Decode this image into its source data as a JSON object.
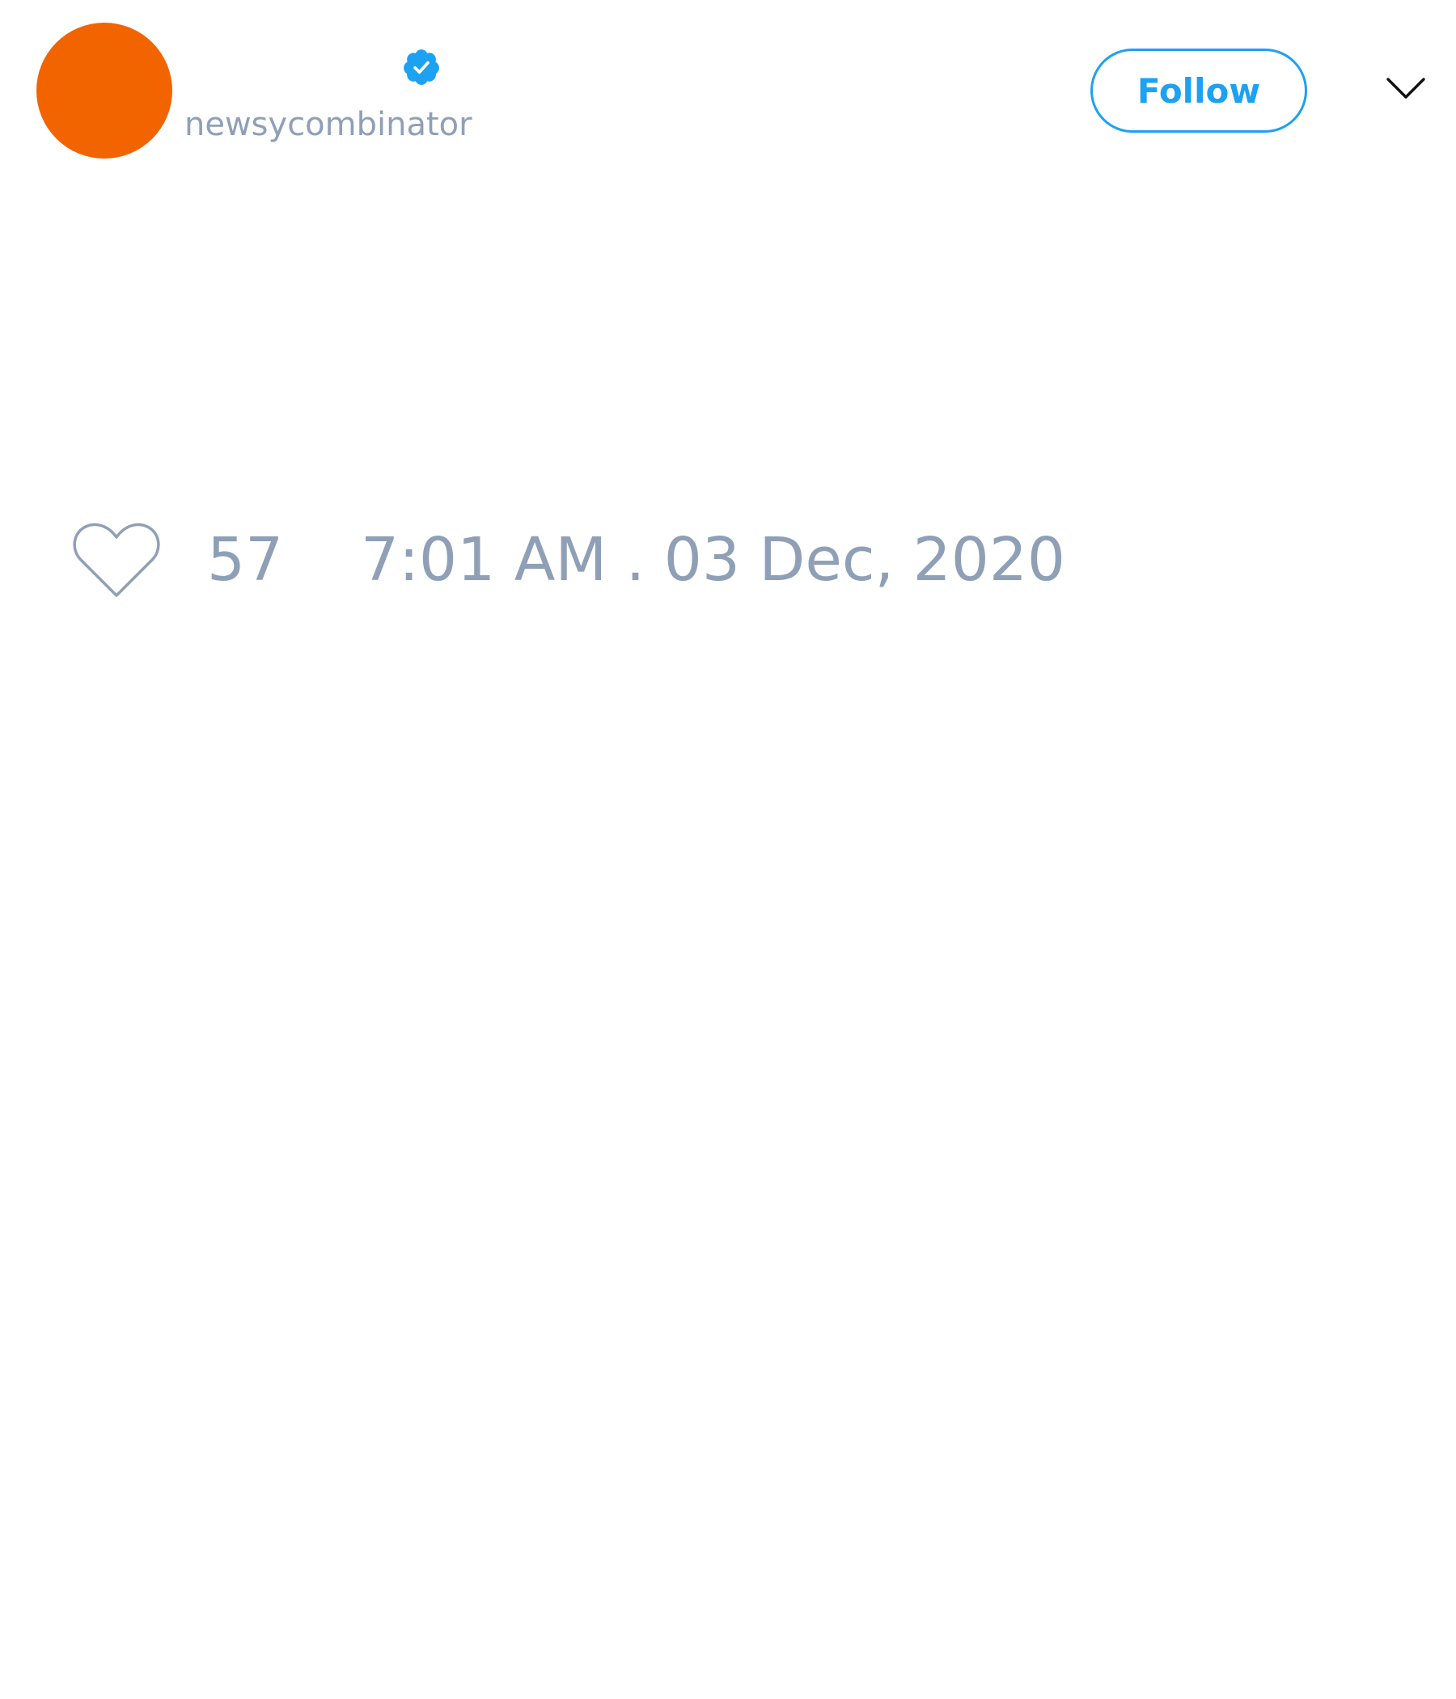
{
  "author": {
    "handle": "newsycombinator",
    "avatar_color": "#f26400",
    "verified_color": "#1da1f2",
    "verified_icon": "verified-badge-icon"
  },
  "actions": {
    "follow_label": "Follow",
    "accent_color": "#1da1f2",
    "menu_icon": "chevron-down-icon"
  },
  "stats": {
    "likes": "57",
    "timestamp": "7:01 AM . 03 Dec, 2020",
    "like_icon": "heart-icon",
    "muted_color": "#8fa0b6"
  }
}
